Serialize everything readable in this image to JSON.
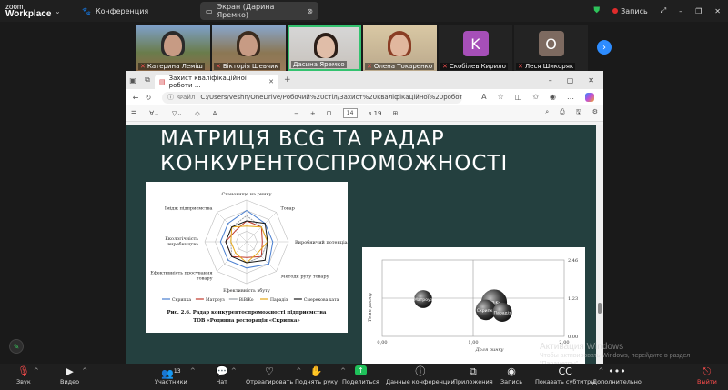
{
  "zoom": {
    "logo_line1": "zoom",
    "logo_line2": "Workplace",
    "tabs": [
      {
        "label": "Конференция"
      },
      {
        "label": "Экран (Дарина Яремко)"
      }
    ],
    "record_label": "Запись",
    "participants_count": "13"
  },
  "participants": [
    {
      "name": "Катерина Леміш",
      "muted": true
    },
    {
      "name": "Вікторія Шевчик",
      "muted": true
    },
    {
      "name": "Дасина Яремко",
      "muted": false
    },
    {
      "name": "Олена Токаренко",
      "muted": true
    },
    {
      "name": "Скобілев Кирило",
      "muted": true,
      "initial": "K"
    },
    {
      "name": "Леся Шикоряк",
      "muted": true,
      "initial": "O"
    }
  ],
  "browser": {
    "tab_title": "Захист кваліфікаційної роботи …",
    "address_label": "Файл",
    "url": "C:/Users/veshn/OneDrive/Робочий%20стіл/Захист%20кваліфікаційної%20роботи%20R…",
    "page_current": "14",
    "page_total": "з 19"
  },
  "slide": {
    "title_line1": "МАТРИЦЯ BCG ТА РАДАР",
    "title_line2": "КОНКУРЕНТОСПРОМОЖНОСТІ"
  },
  "chart_data": [
    {
      "type": "radar",
      "axes": [
        "Становище на ринку",
        "Товар",
        "Виробничий потенціал",
        "Методи руху товару",
        "Ефективність збуту",
        "Ефективність просування товару",
        "Екологічність виробництва",
        "Імідж підприємства"
      ],
      "series": [
        {
          "name": "Скрипка",
          "color": "#4a7fd0",
          "values": [
            6,
            5,
            5,
            6,
            5,
            5,
            5,
            5
          ]
        },
        {
          "name": "Матроуз",
          "color": "#c0392b",
          "values": [
            4,
            4,
            3,
            4,
            3,
            4,
            4,
            3
          ]
        },
        {
          "name": "BiBiKo",
          "color": "#9aa0a6",
          "values": [
            5,
            4,
            4,
            4,
            4,
            4,
            3,
            4
          ]
        },
        {
          "name": "Парадіз",
          "color": "#e6a817",
          "values": [
            3,
            4,
            4,
            3,
            4,
            3,
            3,
            4
          ]
        },
        {
          "name": "Смерекова хата",
          "color": "#1a1a1a",
          "values": [
            4,
            5,
            4,
            5,
            4,
            4,
            4,
            4
          ]
        }
      ],
      "rmax": 8,
      "caption_line1": "Рис. 2.6. Радар конкурентоспроможності підприємства",
      "caption_line2": "ТОВ «Родинна ресторація «Скрипка»"
    },
    {
      "type": "scatter",
      "xlabel": "Доля ринку",
      "ylabel": "Темп росту",
      "xticks": [
        "0,00",
        "1,00",
        "2,00"
      ],
      "yticks": [
        "2,46",
        "1,23",
        "0,00"
      ],
      "xlim": [
        0,
        2
      ],
      "ylim": [
        0,
        2.46
      ],
      "points": [
        {
          "label": "Матроуз",
          "x": 0.45,
          "y": 1.2,
          "size": 0.35
        },
        {
          "label": "BiBiKo",
          "x": 1.23,
          "y": 1.1,
          "size": 0.65
        },
        {
          "label": "Скрипка",
          "x": 1.14,
          "y": 0.85,
          "size": 0.45
        },
        {
          "label": "Парадіз",
          "x": 1.32,
          "y": 0.78,
          "size": 0.4
        }
      ]
    }
  ],
  "watermark": {
    "line1": "Активация Windows",
    "line2": "Чтобы активировать Windows, перейдите в раздел",
    "line3": "\"Параметры\"."
  },
  "toolbar": {
    "audio": "Звук",
    "video": "Видео",
    "participants": "Участники",
    "chat": "Чат",
    "react": "Отреагировать",
    "raise_hand": "Поднять руку",
    "share": "Поделиться",
    "info": "Данные конференции",
    "apps": "Приложения",
    "record": "Запись",
    "captions": "Показать субтитры",
    "more": "Дополнительно",
    "leave": "Выйти"
  }
}
